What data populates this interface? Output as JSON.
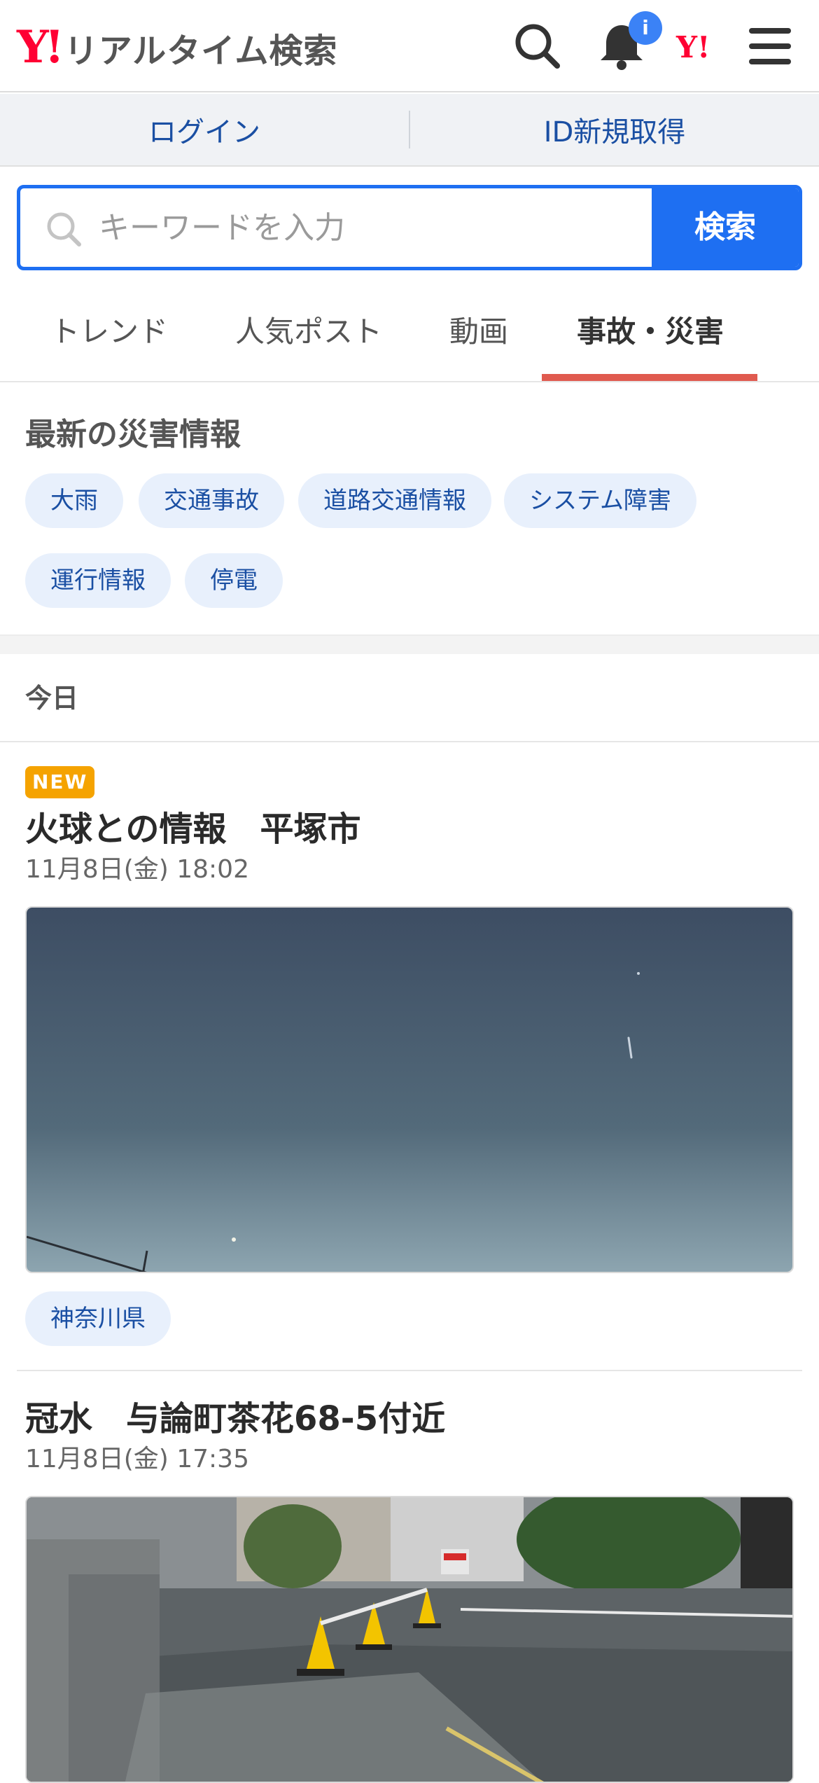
{
  "header": {
    "logo_mark": "Y!",
    "logo_text": "リアルタイム検索",
    "notification_badge": "i",
    "brand_color": "#ff0033"
  },
  "auth": {
    "login": "ログイン",
    "register": "ID新規取得"
  },
  "search": {
    "placeholder": "キーワードを入力",
    "button": "検索"
  },
  "tabs": [
    {
      "label": "トレンド",
      "active": false
    },
    {
      "label": "人気ポスト",
      "active": false
    },
    {
      "label": "動画",
      "active": false
    },
    {
      "label": "事故・災害",
      "active": true
    }
  ],
  "disaster": {
    "title": "最新の災害情報",
    "chips": [
      "大雨",
      "交通事故",
      "道路交通情報",
      "システム障害",
      "運行情報",
      "停電"
    ]
  },
  "feed": {
    "day_label": "今日",
    "posts": [
      {
        "badge": "NEW",
        "title": "火球との情報　平塚市",
        "time": "11月8日(金) 18:02",
        "tag": "神奈川県"
      },
      {
        "title": "冠水　与論町茶花68-5付近",
        "time": "11月8日(金) 17:35"
      }
    ]
  },
  "icons": [
    "search-icon",
    "bell-icon",
    "yahoo-japan-icon",
    "menu-icon"
  ]
}
